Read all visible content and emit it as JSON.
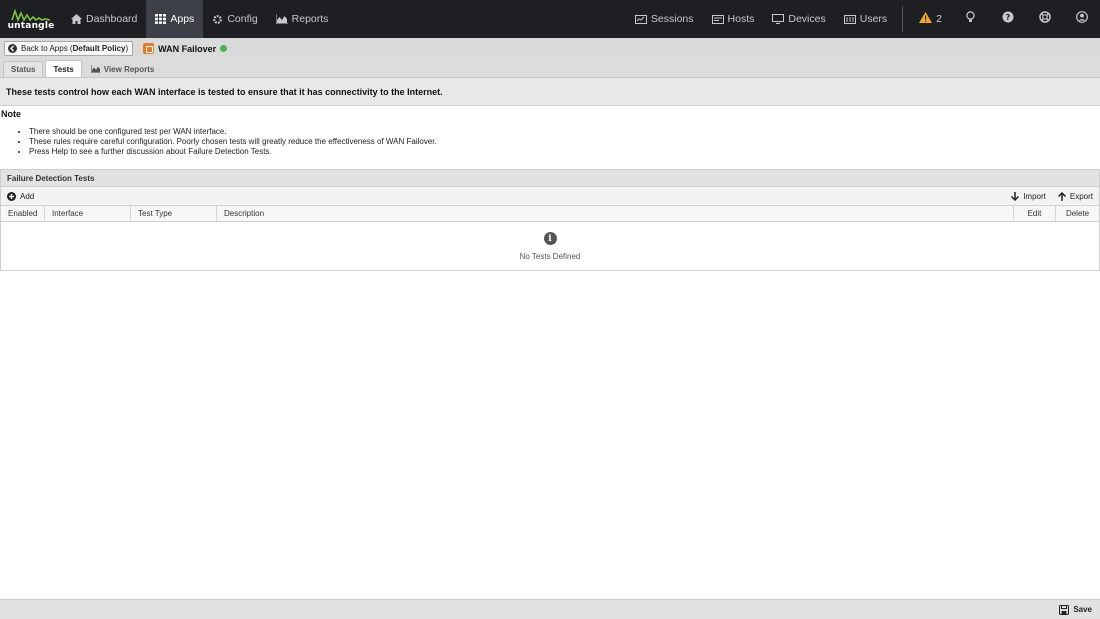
{
  "brand": {
    "logo_text": "untangle",
    "accent": "#7cc142"
  },
  "nav": {
    "left": [
      {
        "label": "Dashboard",
        "icon": "home-icon"
      },
      {
        "label": "Apps",
        "icon": "grid-icon",
        "active": true
      },
      {
        "label": "Config",
        "icon": "gear-icon"
      },
      {
        "label": "Reports",
        "icon": "area-chart-icon"
      }
    ],
    "right": [
      {
        "label": "Sessions",
        "icon": "sessions-icon"
      },
      {
        "label": "Hosts",
        "icon": "hosts-icon"
      },
      {
        "label": "Devices",
        "icon": "devices-icon"
      },
      {
        "label": "Users",
        "icon": "users-icon"
      }
    ],
    "alert_count": "2",
    "alert_color": "#f5a623"
  },
  "breadcrumb": {
    "back_prefix": "Back to Apps (",
    "policy": "Default Policy",
    "back_suffix": ")",
    "app_name": "WAN Failover",
    "app_status_color": "#4caf50"
  },
  "tabs": [
    {
      "label": "Status"
    },
    {
      "label": "Tests",
      "active": true
    },
    {
      "label": "View Reports",
      "icon": "area-chart-icon"
    }
  ],
  "description": "These tests control how each WAN interface is tested to ensure that it has connectivity to the Internet.",
  "note": {
    "title": "Note",
    "items": [
      "There should be one configured test per WAN interface.",
      "These rules require careful configuration. Poorly chosen tests will greatly reduce the effectiveness of WAN Failover.",
      "Press Help to see a further discussion about Failure Detection Tests."
    ]
  },
  "grid": {
    "title": "Failure Detection Tests",
    "add_label": "Add",
    "import_label": "Import",
    "export_label": "Export",
    "columns": [
      "Enabled",
      "Interface",
      "Test Type",
      "Description",
      "Edit",
      "Delete"
    ],
    "empty_text": "No Tests Defined"
  },
  "footer": {
    "save_label": "Save"
  }
}
